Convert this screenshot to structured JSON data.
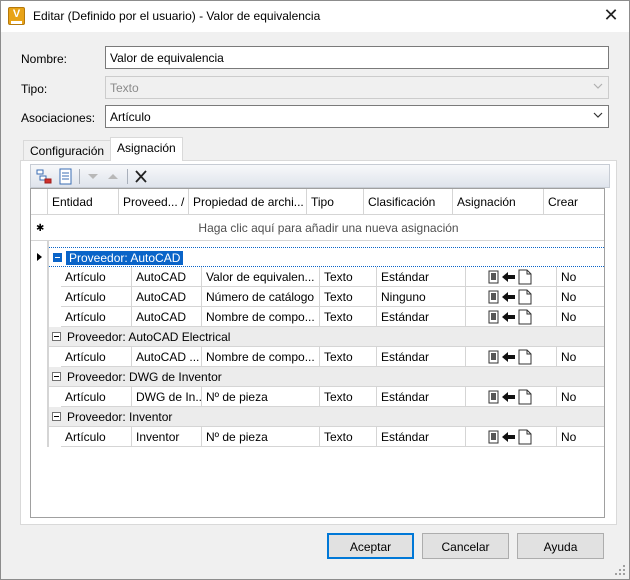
{
  "window": {
    "title": "Editar (Definido por el usuario) - Valor de equivalencia",
    "close_glyph": "✕"
  },
  "form": {
    "nombre_label": "Nombre:",
    "nombre_value": "Valor de equivalencia",
    "tipo_label": "Tipo:",
    "tipo_value": "Texto",
    "asociaciones_label": "Asociaciones:",
    "asociaciones_value": "Artículo"
  },
  "tabs": [
    {
      "label": "Configuración"
    },
    {
      "label": "Asignación"
    }
  ],
  "grid": {
    "columns": [
      "Entidad",
      "Proveed... /",
      "Propiedad de archi...",
      "Tipo",
      "Clasificación",
      "Asignación",
      "Crear"
    ],
    "new_row_hint": "Haga clic aquí para añadir una nueva asignación",
    "groups": [
      {
        "label": "Proveedor: AutoCAD",
        "rows": [
          [
            "Artículo",
            "AutoCAD",
            "Valor de equivalen...",
            "Texto",
            "Estándar",
            "No"
          ],
          [
            "Artículo",
            "AutoCAD",
            "Número de catálogo",
            "Texto",
            "Ninguno",
            "No"
          ],
          [
            "Artículo",
            "AutoCAD",
            "Nombre de compo...",
            "Texto",
            "Estándar",
            "No"
          ]
        ]
      },
      {
        "label": "Proveedor: AutoCAD Electrical",
        "rows": [
          [
            "Artículo",
            "AutoCAD ...",
            "Nombre de compo...",
            "Texto",
            "Estándar",
            "No"
          ]
        ]
      },
      {
        "label": "Proveedor: DWG de Inventor",
        "rows": [
          [
            "Artículo",
            "DWG de In...",
            "Nº de pieza",
            "Texto",
            "Estándar",
            "No"
          ]
        ]
      },
      {
        "label": "Proveedor: Inventor",
        "rows": [
          [
            "Artículo",
            "Inventor",
            "Nº de pieza",
            "Texto",
            "Estándar",
            "No"
          ]
        ]
      }
    ]
  },
  "buttons": {
    "accept": "Aceptar",
    "cancel": "Cancelar",
    "help": "Ayuda"
  },
  "colors": {
    "selection": "#0a64c8",
    "default_button_border": "#0078d7",
    "app_icon": "#e8a317"
  }
}
